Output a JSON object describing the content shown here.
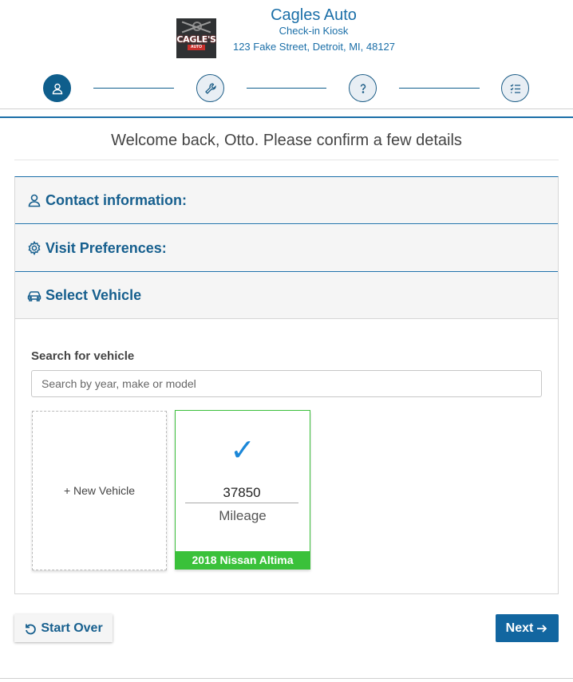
{
  "header": {
    "logo_text": "CAGLE'S",
    "logo_sub": "AUTO",
    "business_name": "Cagles Auto",
    "subtitle": "Check-in Kiosk",
    "address": "123 Fake Street, Detroit, MI, 48127"
  },
  "steps": [
    {
      "icon": "user-icon",
      "active": true
    },
    {
      "icon": "wrench-icon",
      "active": false
    },
    {
      "icon": "question-icon",
      "active": false
    },
    {
      "icon": "checklist-icon",
      "active": false
    }
  ],
  "welcome": "Welcome back, Otto. Please confirm a few details",
  "accordion": {
    "contact": "Contact information:",
    "preferences": "Visit Preferences:",
    "vehicle": "Select Vehicle"
  },
  "search": {
    "label": "Search for vehicle",
    "placeholder": "Search by year, make or model",
    "value": ""
  },
  "vehicles": {
    "new_label": "+ New Vehicle",
    "selected": {
      "check": "✓",
      "mileage": "37850",
      "mileage_label": "Mileage",
      "name": "2018 Nissan Altima"
    }
  },
  "buttons": {
    "start_over": "Start Over",
    "next": "Next"
  },
  "colors": {
    "primary": "#1266a0",
    "accent_green": "#3ac13a",
    "check_blue": "#1b87d8"
  }
}
